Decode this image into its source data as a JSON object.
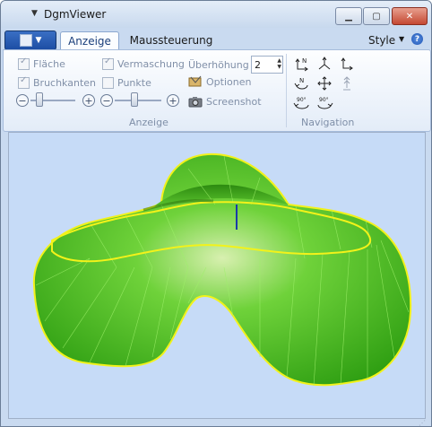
{
  "window": {
    "title": "DgmViewer",
    "title_icon": "caret-down"
  },
  "tabs": [
    {
      "label": "Anzeige",
      "active": true
    },
    {
      "label": "Maussteuerung",
      "active": false
    }
  ],
  "style_label": "Style",
  "anzeige": {
    "checkboxes": [
      {
        "label": "Fläche",
        "checked": true
      },
      {
        "label": "Vermaschung",
        "checked": true
      },
      {
        "label": "Bruchkanten",
        "checked": true
      },
      {
        "label": "Punkte",
        "checked": false
      }
    ],
    "ueberhoehung_label": "Überhöhung",
    "ueberhoehung_value": "2",
    "optionen_label": "Optionen",
    "screenshot_label": "Screenshot",
    "group_label": "Anzeige"
  },
  "navigation": {
    "group_label": "Navigation",
    "buttons": [
      {
        "name": "north-up",
        "glyph": "N"
      },
      {
        "name": "axes-3d",
        "glyph": "⅄"
      },
      {
        "name": "axes-2d",
        "glyph": "∟"
      },
      {
        "name": "rotate-north",
        "glyph": "N"
      },
      {
        "name": "pan",
        "glyph": "✥"
      },
      {
        "name": "vertical-exaggerate",
        "glyph": "⇞"
      },
      {
        "name": "rotate-90-left",
        "glyph": "90°"
      },
      {
        "name": "rotate-90-right",
        "glyph": "90°"
      }
    ]
  },
  "colors": {
    "surface": "#3fb51f",
    "edge": "#f0f21c",
    "background": "#c6dbf7"
  }
}
